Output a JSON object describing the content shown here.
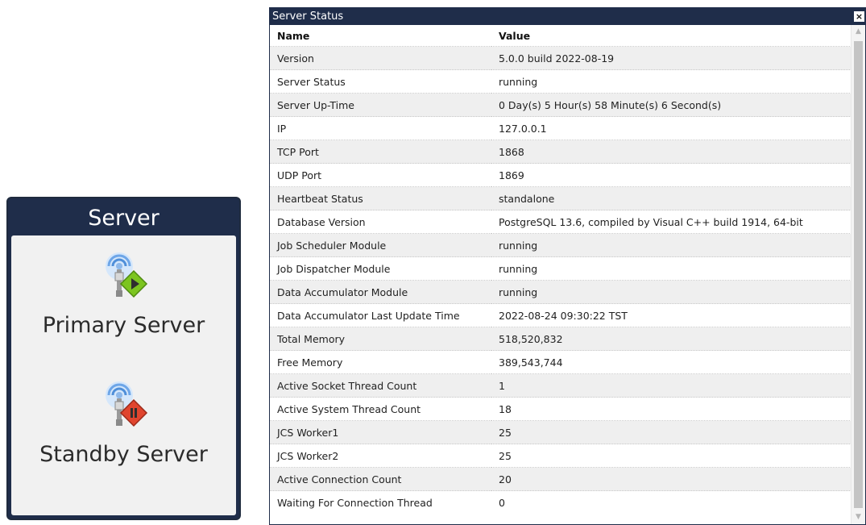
{
  "server_panel": {
    "title": "Server",
    "primary": {
      "label": "Primary Server",
      "icon": "server-running-icon",
      "badge_color": "#7cc520"
    },
    "standby": {
      "label": "Standby Server",
      "icon": "server-paused-icon",
      "badge_color": "#e0452e"
    }
  },
  "status_dialog": {
    "title": "Server Status",
    "close_label": "×",
    "columns": {
      "name": "Name",
      "value": "Value"
    },
    "rows": [
      {
        "name": "Version",
        "value": "5.0.0 build 2022-08-19"
      },
      {
        "name": "Server Status",
        "value": "running"
      },
      {
        "name": "Server Up-Time",
        "value": "0 Day(s) 5 Hour(s) 58 Minute(s) 6 Second(s)"
      },
      {
        "name": "IP",
        "value": "127.0.0.1"
      },
      {
        "name": "TCP Port",
        "value": "1868"
      },
      {
        "name": "UDP Port",
        "value": "1869"
      },
      {
        "name": "Heartbeat Status",
        "value": "standalone"
      },
      {
        "name": "Database Version",
        "value": "PostgreSQL 13.6, compiled by Visual C++ build 1914, 64-bit"
      },
      {
        "name": "Job Scheduler Module",
        "value": "running"
      },
      {
        "name": "Job Dispatcher Module",
        "value": "running"
      },
      {
        "name": "Data Accumulator Module",
        "value": "running"
      },
      {
        "name": "Data Accumulator Last Update Time",
        "value": "2022-08-24 09:30:22 TST"
      },
      {
        "name": "Total Memory",
        "value": "518,520,832"
      },
      {
        "name": "Free Memory",
        "value": "389,543,744"
      },
      {
        "name": "Active Socket Thread Count",
        "value": "1"
      },
      {
        "name": "Active System Thread Count",
        "value": "18"
      },
      {
        "name": "JCS Worker1",
        "value": "25"
      },
      {
        "name": "JCS Worker2",
        "value": "25"
      },
      {
        "name": "Active Connection Count",
        "value": "20"
      },
      {
        "name": "Waiting For Connection Thread",
        "value": "0"
      }
    ]
  },
  "colors": {
    "header_navy": "#1f2d4a",
    "row_alt": "#efefef",
    "panel_body": "#f1f1f1"
  }
}
